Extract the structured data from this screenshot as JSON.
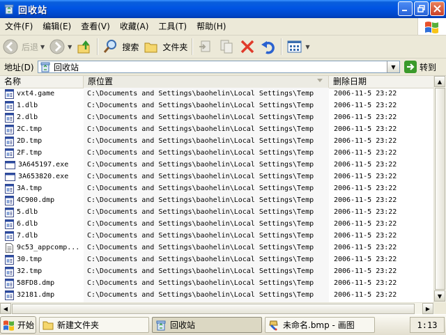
{
  "window": {
    "title": "回收站"
  },
  "menu": [
    "文件(F)",
    "编辑(E)",
    "查看(V)",
    "收藏(A)",
    "工具(T)",
    "帮助(H)"
  ],
  "toolbar": {
    "back": "后退",
    "search": "搜索",
    "folders": "文件夹"
  },
  "address": {
    "label": "地址(D)",
    "value": "回收站",
    "go": "转到"
  },
  "columns": {
    "name": "名称",
    "path": "原位置",
    "date": "删除日期"
  },
  "files": [
    {
      "name": "vxt4.game",
      "path": "C:\\Documents and Settings\\baohelin\\Local Settings\\Temp",
      "date": "2006-11-5 23:22",
      "icon": "dll-file-icon"
    },
    {
      "name": "1.dlb",
      "path": "C:\\Documents and Settings\\baohelin\\Local Settings\\Temp",
      "date": "2006-11-5 23:22",
      "icon": "dll-file-icon"
    },
    {
      "name": "2.dlb",
      "path": "C:\\Documents and Settings\\baohelin\\Local Settings\\Temp",
      "date": "2006-11-5 23:22",
      "icon": "dll-file-icon"
    },
    {
      "name": "2C.tmp",
      "path": "C:\\Documents and Settings\\baohelin\\Local Settings\\Temp",
      "date": "2006-11-5 23:22",
      "icon": "dll-file-icon"
    },
    {
      "name": "2D.tmp",
      "path": "C:\\Documents and Settings\\baohelin\\Local Settings\\Temp",
      "date": "2006-11-5 23:22",
      "icon": "dll-file-icon"
    },
    {
      "name": "2F.tmp",
      "path": "C:\\Documents and Settings\\baohelin\\Local Settings\\Temp",
      "date": "2006-11-5 23:22",
      "icon": "dll-file-icon"
    },
    {
      "name": "3A645197.exe",
      "path": "C:\\Documents and Settings\\baohelin\\Local Settings\\Temp",
      "date": "2006-11-5 23:22",
      "icon": "exe-file-icon"
    },
    {
      "name": "3A653820.exe",
      "path": "C:\\Documents and Settings\\baohelin\\Local Settings\\Temp",
      "date": "2006-11-5 23:22",
      "icon": "exe-file-icon"
    },
    {
      "name": "3A.tmp",
      "path": "C:\\Documents and Settings\\baohelin\\Local Settings\\Temp",
      "date": "2006-11-5 23:22",
      "icon": "dll-file-icon"
    },
    {
      "name": "4C900.dmp",
      "path": "C:\\Documents and Settings\\baohelin\\Local Settings\\Temp",
      "date": "2006-11-5 23:22",
      "icon": "dll-file-icon"
    },
    {
      "name": "5.dlb",
      "path": "C:\\Documents and Settings\\baohelin\\Local Settings\\Temp",
      "date": "2006-11-5 23:22",
      "icon": "dll-file-icon"
    },
    {
      "name": "6.dlb",
      "path": "C:\\Documents and Settings\\baohelin\\Local Settings\\Temp",
      "date": "2006-11-5 23:22",
      "icon": "dll-file-icon"
    },
    {
      "name": "7.dlb",
      "path": "C:\\Documents and Settings\\baohelin\\Local Settings\\Temp",
      "date": "2006-11-5 23:22",
      "icon": "dll-file-icon"
    },
    {
      "name": "9c53_appcomp...",
      "path": "C:\\Documents and Settings\\baohelin\\Local Settings\\Temp",
      "date": "2006-11-5 23:22",
      "icon": "text-file-icon"
    },
    {
      "name": "30.tmp",
      "path": "C:\\Documents and Settings\\baohelin\\Local Settings\\Temp",
      "date": "2006-11-5 23:22",
      "icon": "dll-file-icon"
    },
    {
      "name": "32.tmp",
      "path": "C:\\Documents and Settings\\baohelin\\Local Settings\\Temp",
      "date": "2006-11-5 23:22",
      "icon": "dll-file-icon"
    },
    {
      "name": "58FD8.dmp",
      "path": "C:\\Documents and Settings\\baohelin\\Local Settings\\Temp",
      "date": "2006-11-5 23:22",
      "icon": "dll-file-icon"
    },
    {
      "name": "32181.dmp",
      "path": "C:\\Documents and Settings\\baohelin\\Local Settings\\Temp",
      "date": "2006-11-5 23:22",
      "icon": "dll-file-icon"
    }
  ],
  "taskbar": {
    "start": "开始",
    "tasks": [
      {
        "label": "新建文件夹",
        "icon": "folder-icon",
        "active": false
      },
      {
        "label": "回收站",
        "icon": "recycle-bin-icon",
        "active": true
      },
      {
        "label": "未命名.bmp - 画图",
        "icon": "paint-icon",
        "active": false
      }
    ],
    "clock": "1:13"
  },
  "colors": {
    "titlebar": "#0054e3",
    "chrome": "#ece9d8",
    "accent_green": "#3a9a2a"
  }
}
